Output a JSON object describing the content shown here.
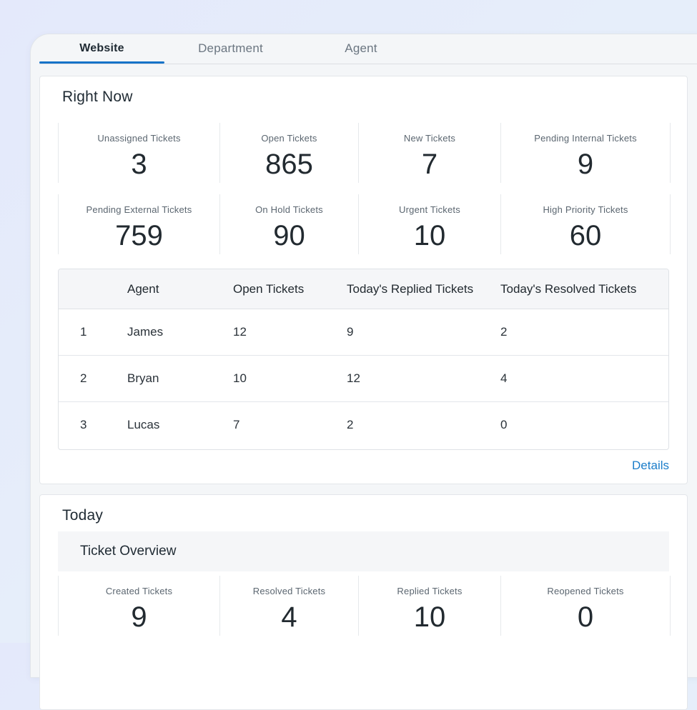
{
  "tabs": [
    {
      "label": "Website",
      "active": true
    },
    {
      "label": "Department",
      "active": false
    },
    {
      "label": "Agent",
      "active": false
    }
  ],
  "right_now": {
    "title": "Right Now",
    "stats_row1": [
      {
        "label": "Unassigned Tickets",
        "value": "3"
      },
      {
        "label": "Open Tickets",
        "value": "865"
      },
      {
        "label": "New Tickets",
        "value": "7"
      },
      {
        "label": "Pending Internal Tickets",
        "value": "9"
      }
    ],
    "stats_row2": [
      {
        "label": "Pending External Tickets",
        "value": "759"
      },
      {
        "label": "On Hold Tickets",
        "value": "90"
      },
      {
        "label": "Urgent Tickets",
        "value": "10"
      },
      {
        "label": "High Priority Tickets",
        "value": "60"
      }
    ],
    "table": {
      "headers": [
        "",
        "Agent",
        "Open Tickets",
        "Today's Replied Tickets",
        "Today's Resolved Tickets"
      ],
      "rows": [
        [
          "1",
          "James",
          "12",
          "9",
          "2"
        ],
        [
          "2",
          "Bryan",
          "10",
          "12",
          "4"
        ],
        [
          "3",
          "Lucas",
          "7",
          "2",
          "0"
        ]
      ]
    },
    "details_label": "Details"
  },
  "today": {
    "title": "Today",
    "overview_title": "Ticket Overview",
    "stats": [
      {
        "label": "Created Tickets",
        "value": "9"
      },
      {
        "label": "Resolved Tickets",
        "value": "4"
      },
      {
        "label": "Replied Tickets",
        "value": "10"
      },
      {
        "label": "Reopened Tickets",
        "value": "0"
      }
    ]
  },
  "colors": {
    "accent": "#1673c8",
    "link": "#1b7dc9"
  }
}
